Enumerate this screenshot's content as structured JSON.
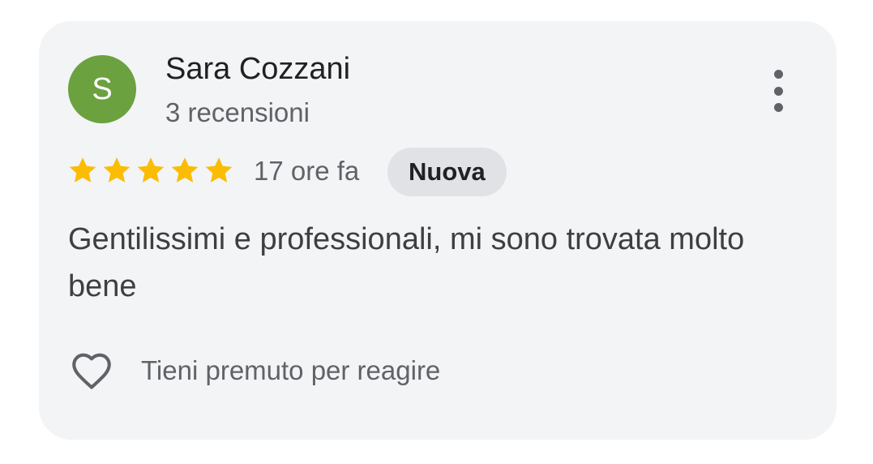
{
  "review": {
    "author": {
      "initial": "S",
      "name": "Sara Cozzani",
      "review_count": "3 recensioni",
      "avatar_color": "#6ba13f"
    },
    "menu_icon": "more-vertical-icon",
    "rating": {
      "value": 5,
      "max": 5,
      "star_color": "#fbbc04"
    },
    "time_ago": "17 ore fa",
    "badge": "Nuova",
    "text": "Gentilissimi e professionali, mi sono trovata molto bene",
    "reaction": {
      "icon": "heart-outline-icon",
      "label": "Tieni premuto per reagire"
    }
  }
}
